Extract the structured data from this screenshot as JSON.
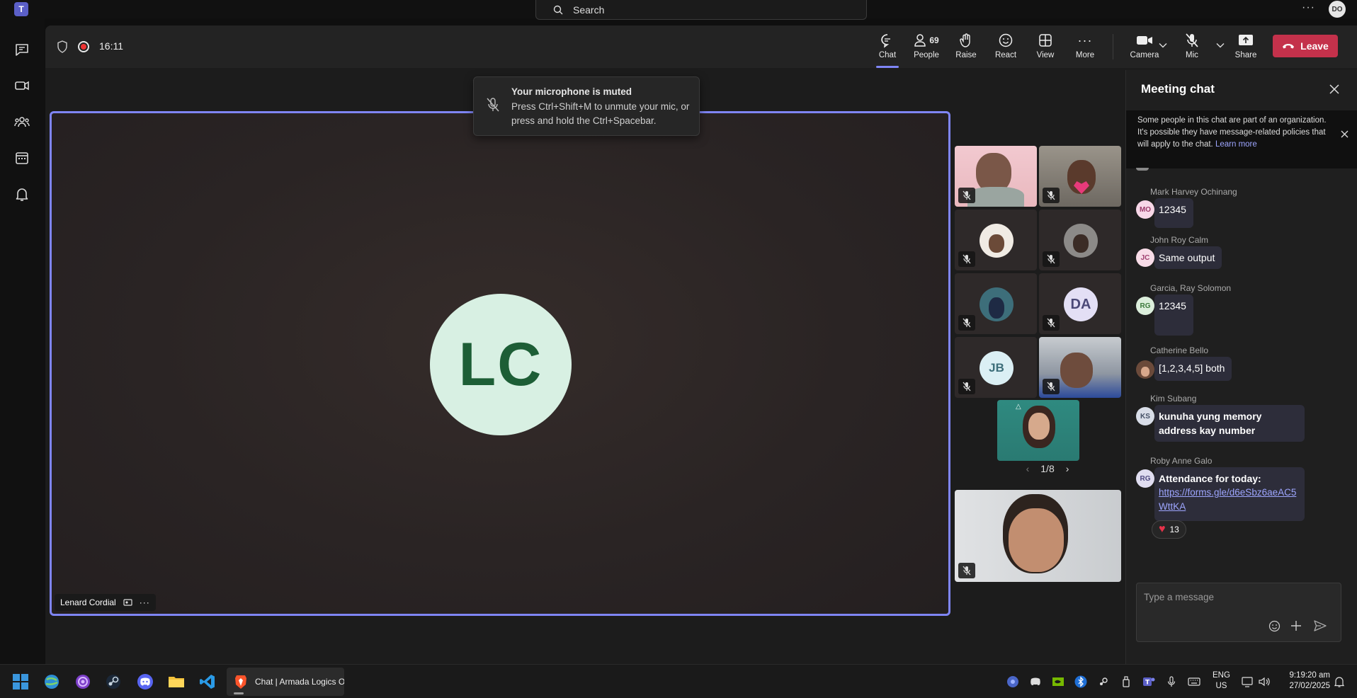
{
  "search": {
    "placeholder": "Search"
  },
  "account": {
    "initials": "DO"
  },
  "meeting": {
    "timer": "16:11",
    "controls": {
      "chat": "Chat",
      "people": "People",
      "people_count": "69",
      "raise": "Raise",
      "react": "React",
      "view": "View",
      "more": "More",
      "camera": "Camera",
      "mic": "Mic",
      "share": "Share",
      "leave": "Leave"
    }
  },
  "toast": {
    "title": "Your microphone is muted",
    "body": "Press Ctrl+Shift+M to unmute your mic, or press and hold the Ctrl+Spacebar."
  },
  "stage": {
    "initials": "LC",
    "name": "Lenard Cordial"
  },
  "gallery": {
    "tiles": [
      {
        "initials": "DA"
      },
      {
        "initials": "JB"
      }
    ],
    "pager": "1/8"
  },
  "chat": {
    "title": "Meeting chat",
    "notice_text": "Some people in this chat are part of an organization. It's possible they have message-related policies that will apply to the chat.",
    "notice_link": "Learn more",
    "messages": [
      {
        "sender": "Mark Harvey Ochinang",
        "initials": "MO",
        "text": "12345",
        "avatar_bg": "#f7d7e8",
        "avatar_fg": "#9a3a6a"
      },
      {
        "sender": "John Roy Calm",
        "initials": "JC",
        "text": "Same output",
        "avatar_bg": "#f8dce8",
        "avatar_fg": "#a04070"
      },
      {
        "sender": "Garcia, Ray Solomon",
        "initials": "RG",
        "text": "12345",
        "avatar_bg": "#dcefdc",
        "avatar_fg": "#3b7a3b"
      },
      {
        "sender": "Catherine Bello",
        "initials": "",
        "text": "[1,2,3,4,5] both",
        "avatar_bg": "#6b4a3a",
        "avatar_fg": "#fff"
      },
      {
        "sender": "Kim Subang",
        "initials": "KS",
        "text": "kunuha yung memory address kay number",
        "avatar_bg": "#d8dde8",
        "avatar_fg": "#445066"
      },
      {
        "sender": "Roby Anne Galo",
        "initials": "RG",
        "text": "Attendance for today:",
        "link": "https://forms.gle/d6eSbz6aeAC5WttKA",
        "avatar_bg": "#e0ddf0",
        "avatar_fg": "#4f4a80",
        "reaction_count": "13"
      }
    ],
    "compose_placeholder": "Type a message"
  },
  "taskbar": {
    "active_app": "Chat | Armada Logics O",
    "lang1": "ENG",
    "lang2": "US",
    "time": "9:19:20 am",
    "date": "27/02/2025"
  },
  "colors": {
    "accent": "#7f85f5",
    "leave": "#c4314b",
    "link": "#9ea6ff"
  }
}
